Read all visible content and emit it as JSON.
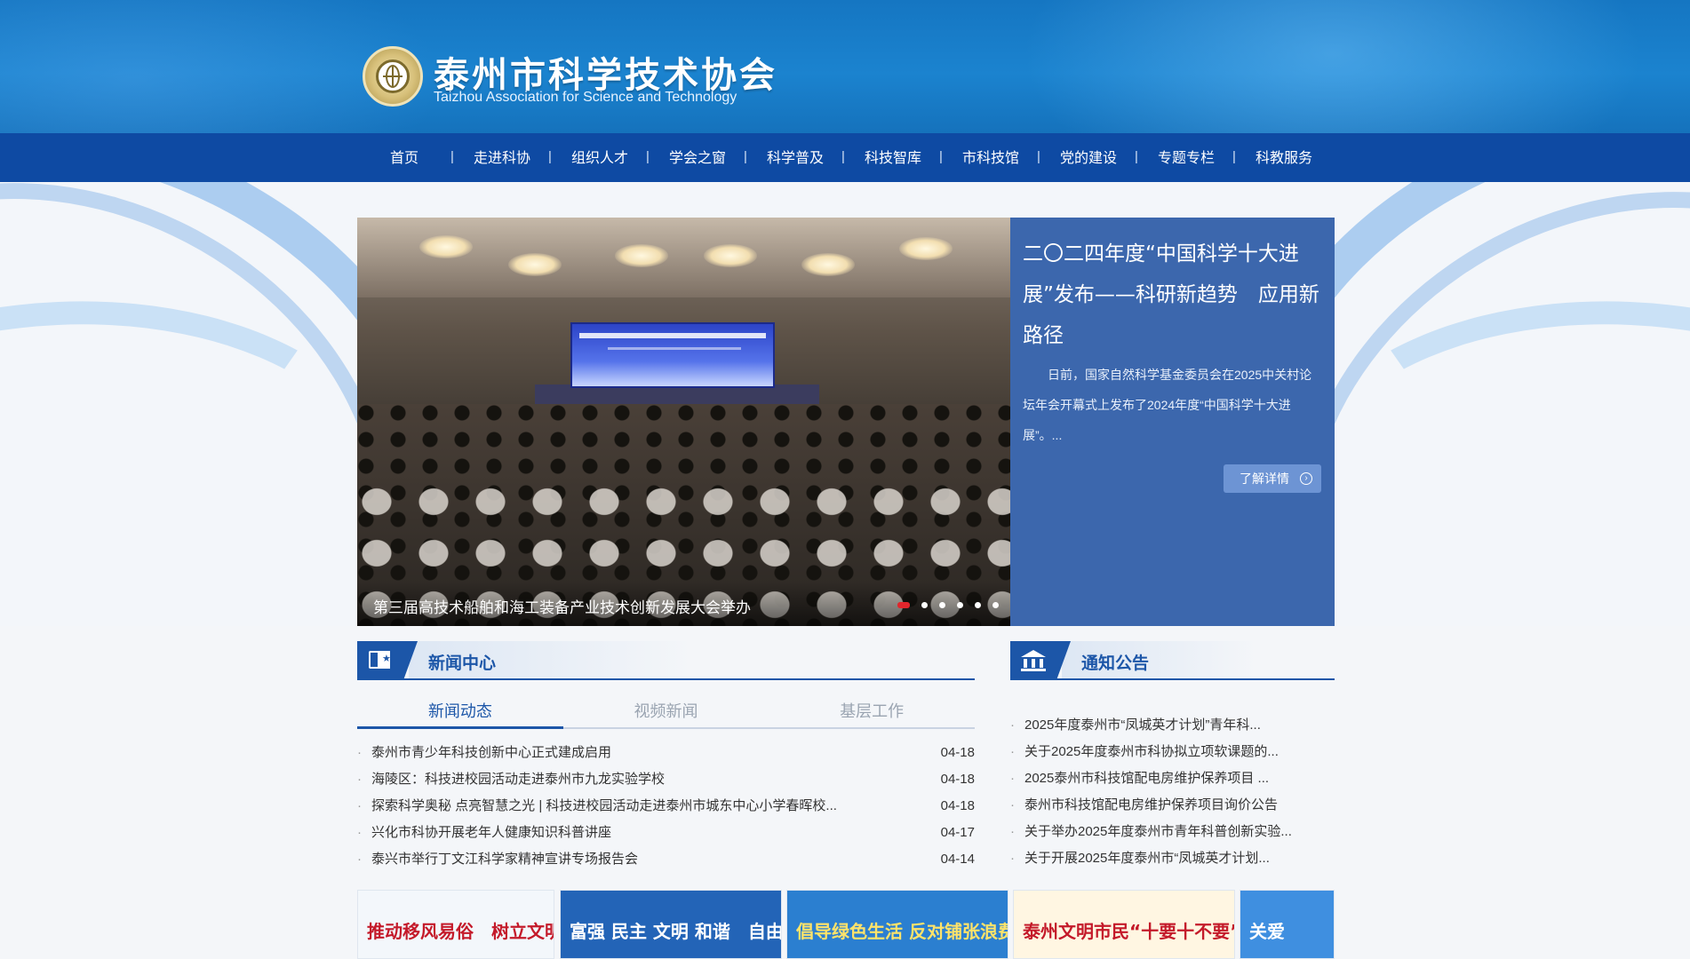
{
  "header": {
    "title": "泰州市科学技术协会",
    "subtitle": "Taizhou Association for Science and Technology"
  },
  "nav": {
    "items": [
      "首页",
      "走进科协",
      "组织人才",
      "学会之窗",
      "科学普及",
      "科技智库",
      "市科技馆",
      "党的建设",
      "专题专栏",
      "科教服务"
    ],
    "separator": "|"
  },
  "banner": {
    "caption": "第三届高技术船舶和海工装备产业技术创新发展大会举办",
    "slide_count": 6,
    "active_slide": 1,
    "feature": {
      "title": "二〇二四年度“中国科学十大进展”发布——科研新趋势　应用新路径",
      "body": "日前，国家自然科学基金委员会在2025中关村论坛年会开幕式上发布了2024年度“中国科学十大进展”。...",
      "more": "了解详情"
    }
  },
  "news": {
    "title": "新闻中心",
    "tabs": [
      {
        "label": "新闻动态",
        "active": true
      },
      {
        "label": "视频新闻",
        "active": false
      },
      {
        "label": "基层工作",
        "active": false
      }
    ],
    "items": [
      {
        "text": "泰州市青少年科技创新中心正式建成启用",
        "date": "04-18"
      },
      {
        "text": "海陵区：科技进校园活动走进泰州市九龙实验学校",
        "date": "04-18"
      },
      {
        "text": "探索科学奥秘 点亮智慧之光 | 科技进校园活动走进泰州市城东中心小学春晖校...",
        "date": "04-18"
      },
      {
        "text": "兴化市科协开展老年人健康知识科普讲座",
        "date": "04-17"
      },
      {
        "text": "泰兴市举行丁文江科学家精神宣讲专场报告会",
        "date": "04-14"
      }
    ]
  },
  "notice": {
    "title": "通知公告",
    "items": [
      "2025年度泰州市“凤城英才计划”青年科...",
      "关于2025年度泰州市科协拟立项软课题的...",
      "2025泰州市科技馆配电房维护保养项目 ...",
      "泰州市科技馆配电房维护保养项目询价公告",
      "关于举办2025年度泰州市青年科普创新实验...",
      "关于开展2025年度泰州市“凤城英才计划..."
    ]
  },
  "strip": {
    "cards": [
      {
        "text": "推动移风易俗　树立文明风尚",
        "bg": "#f3f7fb",
        "fg": "#c41a2a"
      },
      {
        "text": "富强 民主 文明 和谐　自由 平等 公正 法治",
        "bg": "#2364b7",
        "fg": "#ffffff"
      },
      {
        "text": "倡导绿色生活 反对铺张浪费",
        "bg": "#2b7fd0",
        "fg": "#ffe36a"
      },
      {
        "text": "泰州文明市民“十要十不要”",
        "bg": "#fff6e2",
        "fg": "#c41a2a"
      },
      {
        "text": "关爱",
        "bg": "#3f8fe0",
        "fg": "#ffffff"
      }
    ]
  },
  "colors": {
    "header_blue": "#1576c2",
    "nav_blue": "#0e4aa3",
    "feature_blue": "#3c67ad",
    "accent_red": "#e0262c",
    "section_blue": "#1c56a8"
  }
}
